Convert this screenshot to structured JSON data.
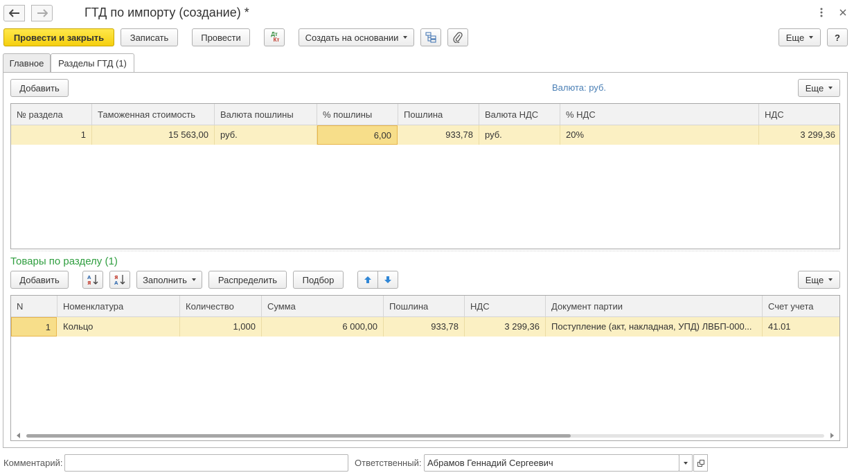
{
  "window": {
    "title": "ГТД по импорту (создание) *",
    "more_icon": "vertical-ellipsis-icon",
    "close_icon": "close-icon"
  },
  "toolbar": {
    "post_close": "Провести и закрыть",
    "save": "Записать",
    "post": "Провести",
    "dtkt_icon_top": "Дт",
    "dtkt_icon_bottom": "Кт",
    "create_based": "Создать на основании",
    "more": "Еще",
    "help": "?"
  },
  "tabs": [
    {
      "label": "Главное"
    },
    {
      "label": "Разделы ГТД (1)"
    }
  ],
  "sections": {
    "add": "Добавить",
    "currency": "Валюта: руб.",
    "more": "Еще",
    "columns": [
      "№ раздела",
      "Таможенная стоимость",
      "Валюта пошлины",
      "% пошлины",
      "Пошлина",
      "Валюта НДС",
      "% НДС",
      "НДС"
    ],
    "rows": [
      [
        "1",
        "15 563,00",
        "руб.",
        "6,00",
        "933,78",
        "руб.",
        "20%",
        "3 299,36"
      ]
    ]
  },
  "goods": {
    "title": "Товары по разделу (1)",
    "add": "Добавить",
    "fill": "Заполнить",
    "distribute": "Распределить",
    "pick": "Подбор",
    "more": "Еще",
    "columns": [
      "N",
      "Номенклатура",
      "Количество",
      "Сумма",
      "Пошлина",
      "НДС",
      "Документ партии",
      "Счет учета"
    ],
    "rows": [
      [
        "1",
        "Кольцо",
        "1,000",
        "6 000,00",
        "933,78",
        "3 299,36",
        "Поступление (акт, накладная, УПД) ЛВБП-000...",
        "41.01"
      ]
    ]
  },
  "footer": {
    "comment_label": "Комментарий:",
    "comment_value": "",
    "responsible_label": "Ответственный:",
    "responsible_value": "Абрамов Геннадий Сергеевич"
  },
  "colors": {
    "accent_yellow": "#f5cf0f",
    "row_highlight": "#fbf0c3",
    "section_title": "#2f9e3f",
    "currency_link": "#4a7fb5"
  }
}
